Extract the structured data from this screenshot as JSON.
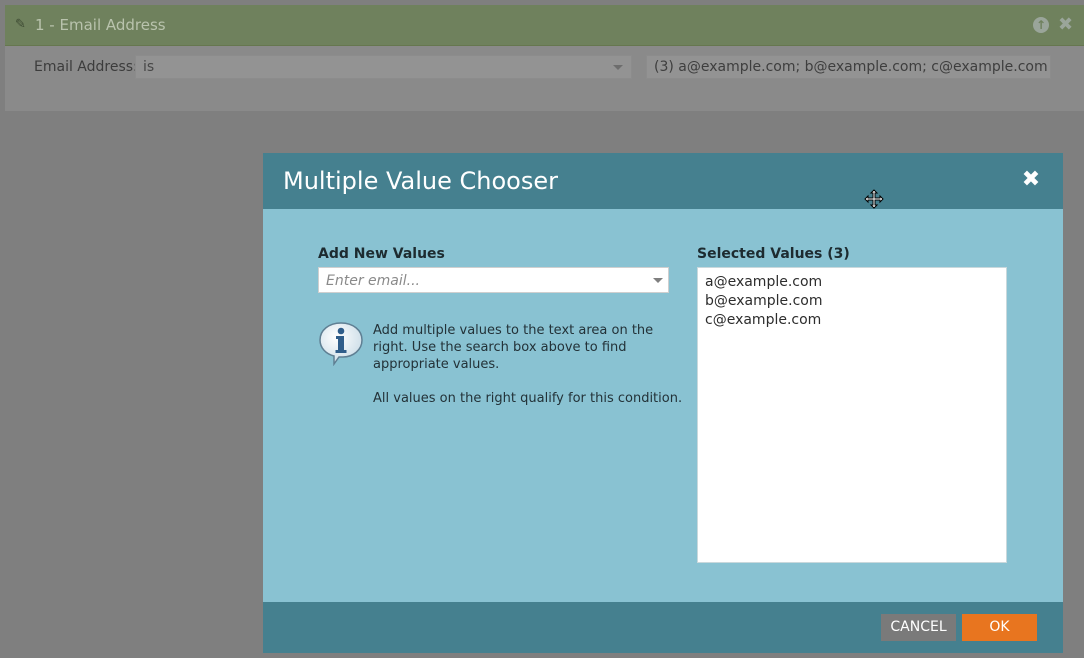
{
  "filter": {
    "title": "1 - Email Address",
    "field_label": "Email Address:",
    "operator": "is",
    "values_summary": "(3) a@example.com; b@example.com; c@example.com",
    "icons": [
      "drag-handle-icon",
      "move-up-icon",
      "close-icon"
    ]
  },
  "modal": {
    "title": "Multiple Value Chooser",
    "add_label": "Add New Values",
    "search_placeholder": "Enter email...",
    "info_line": "Add multiple values to the text area on the right. Use the search box above to find appropriate values.",
    "info_line2": "All values on the right qualify for this condition.",
    "selected_label": "Selected Values (3)",
    "selected_values": [
      "a@example.com",
      "b@example.com",
      "c@example.com"
    ],
    "cancel_label": "CANCEL",
    "ok_label": "OK",
    "colors": {
      "header": "#45808f",
      "body": "#89c2d2",
      "ok": "#e8751f",
      "cancel": "#7a7a7a"
    }
  }
}
